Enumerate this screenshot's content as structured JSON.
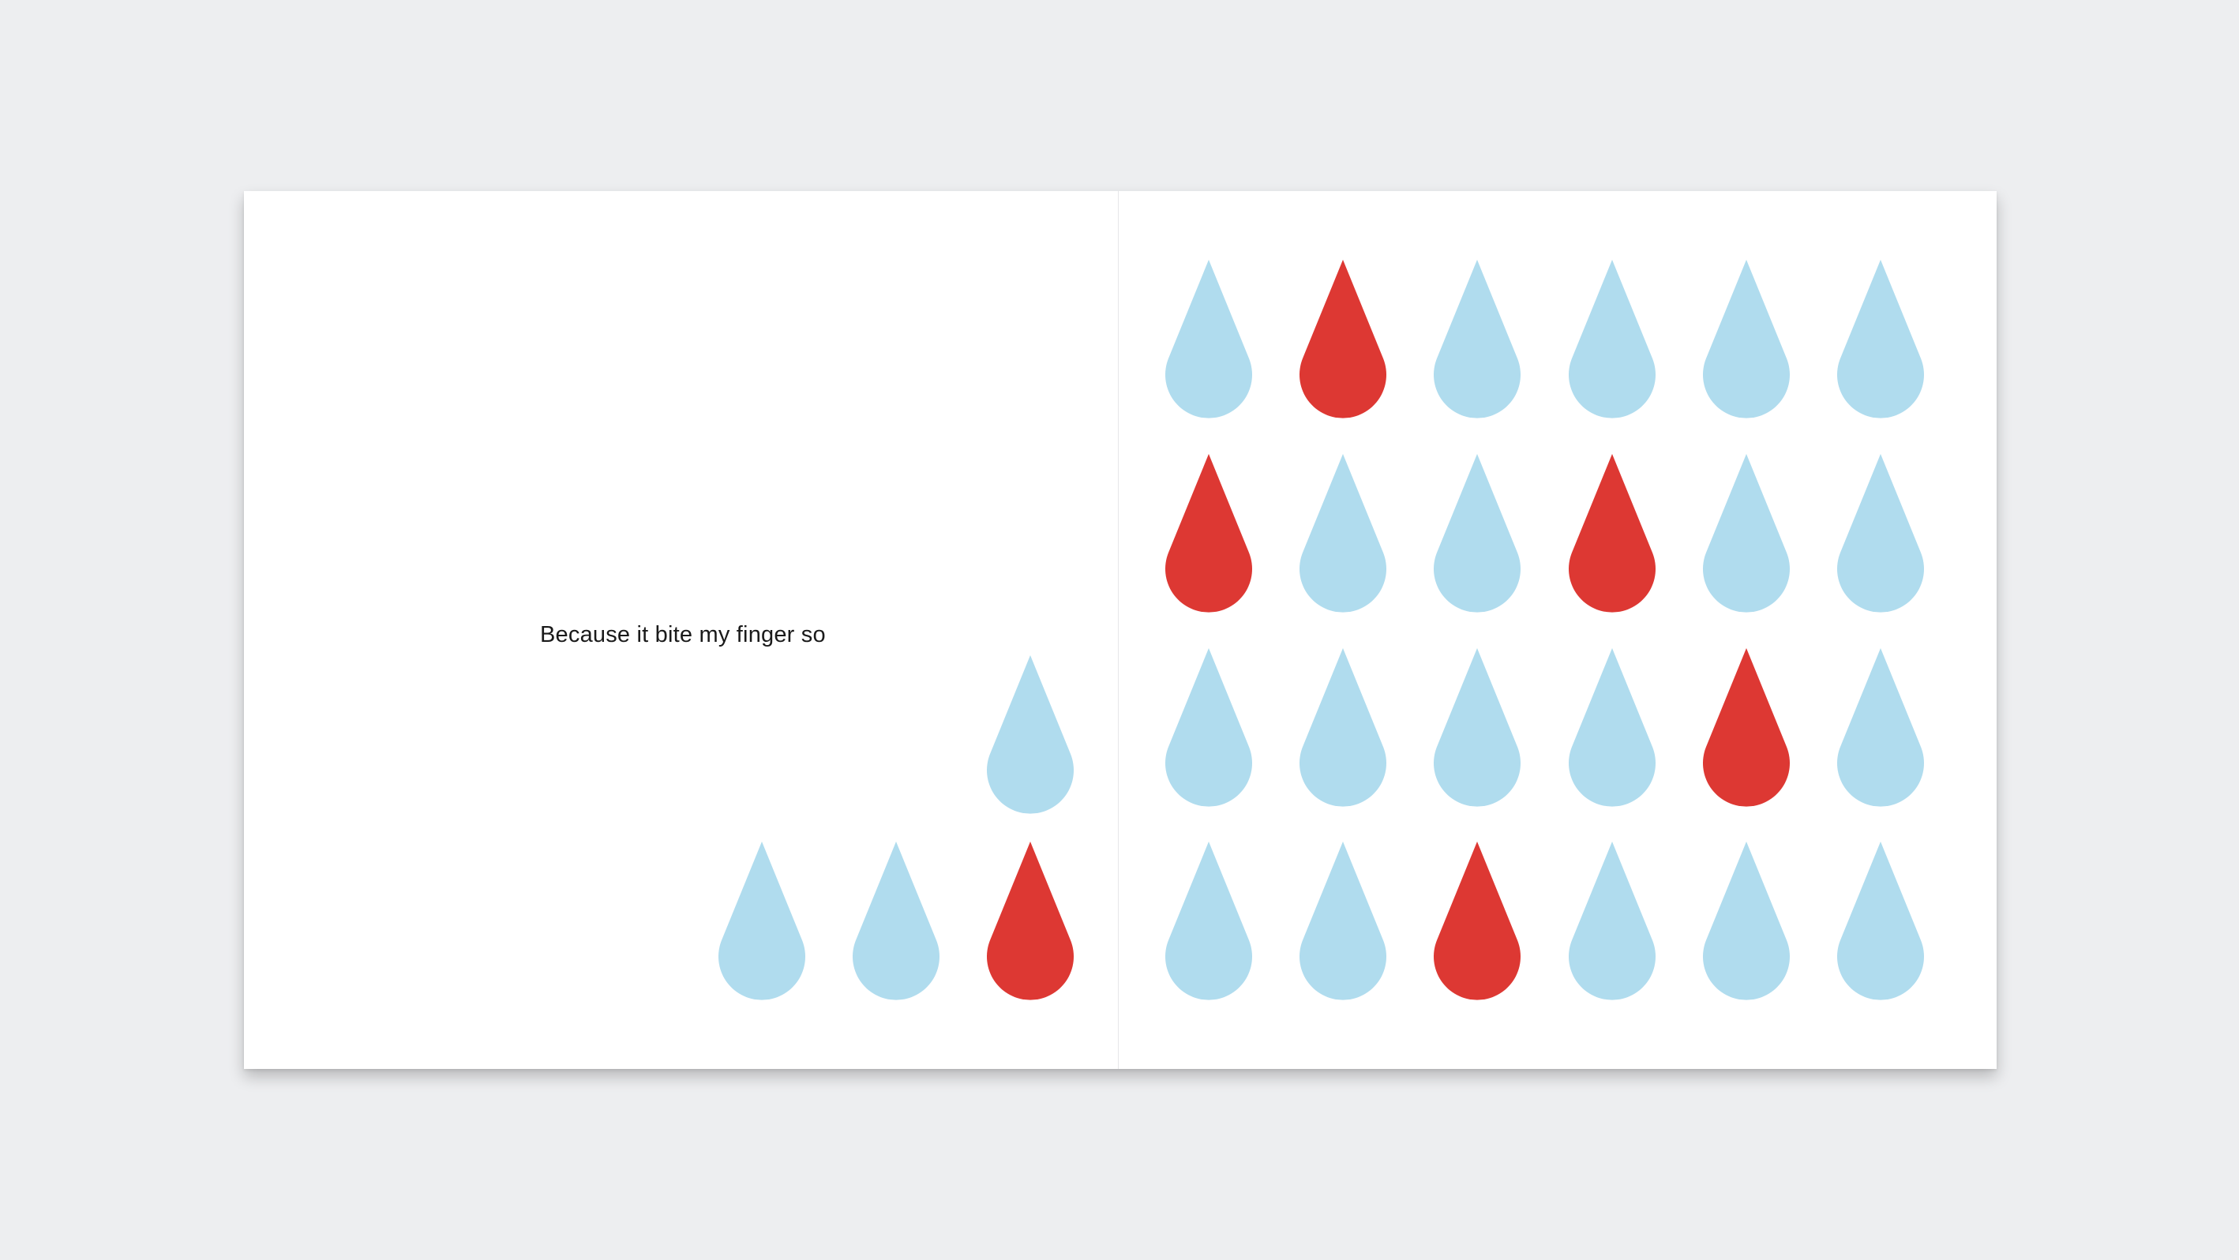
{
  "colors": {
    "background": "#edeef0",
    "page": "#ffffff",
    "drop_blue": "#b0dcee",
    "drop_red": "#dd3833",
    "text": "#1a1a1a"
  },
  "left_page": {
    "text": "Because it bite my finger so",
    "drops": [
      [
        "blue",
        "blue",
        "red"
      ]
    ],
    "top_drop": "blue"
  },
  "right_page": {
    "rows": [
      [
        "blue",
        "red",
        "blue",
        "blue",
        "blue",
        "blue"
      ],
      [
        "red",
        "blue",
        "blue",
        "red",
        "blue",
        "blue"
      ],
      [
        "blue",
        "blue",
        "blue",
        "blue",
        "red",
        "blue"
      ],
      [
        "blue",
        "blue",
        "red",
        "blue",
        "blue",
        "blue"
      ]
    ]
  }
}
